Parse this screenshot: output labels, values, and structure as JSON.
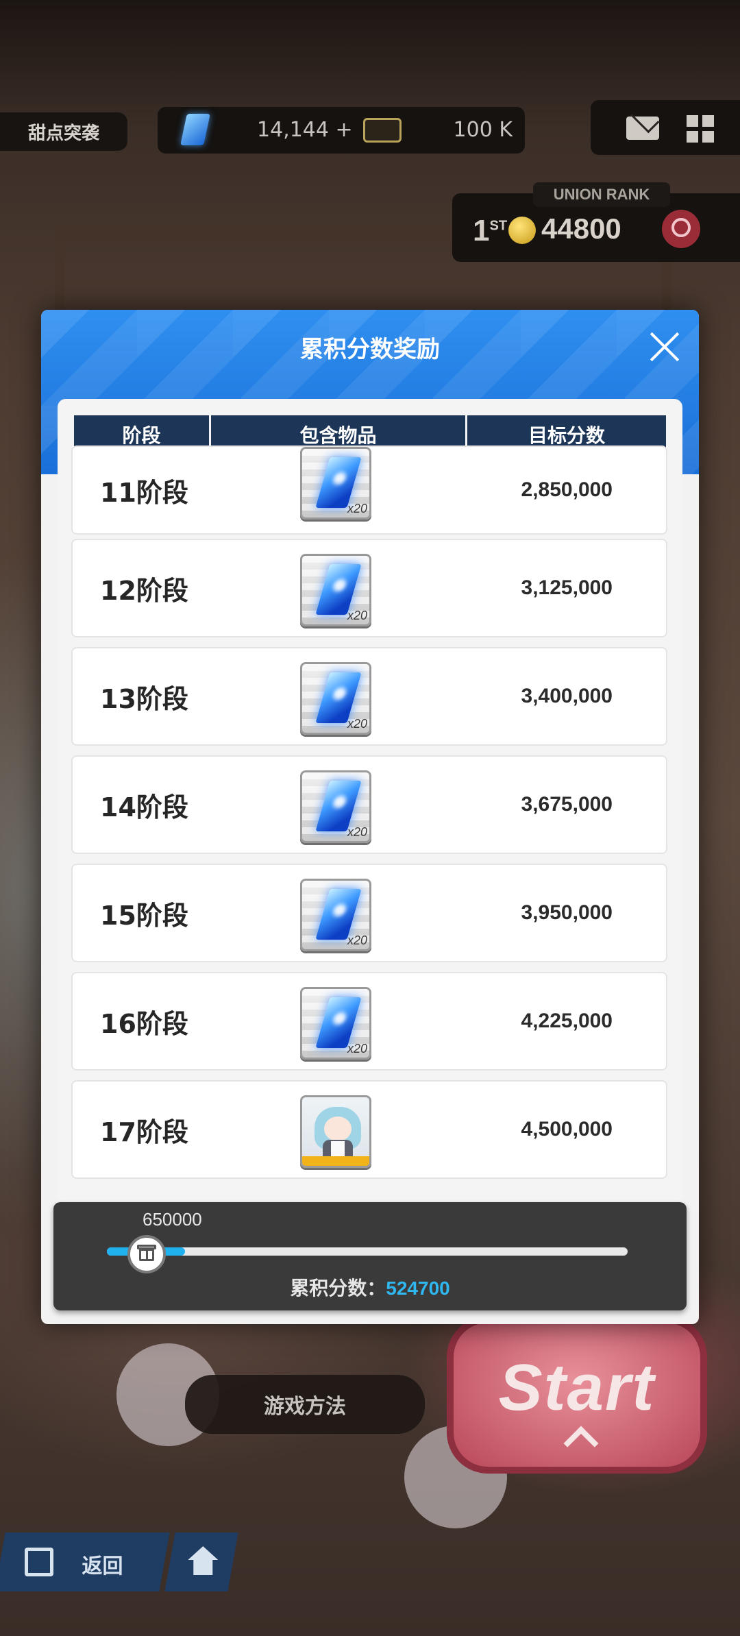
{
  "top_bar": {
    "event_name": "甜点突袭",
    "gems": "14,144",
    "gems_plus": "+",
    "credits": "100 K"
  },
  "union": {
    "label": "UNION RANK",
    "rank": "1",
    "rank_suffix": "ST",
    "score": "44800"
  },
  "background_buttons": {
    "how_to_play": "游戏方法",
    "start": "Start",
    "back": "返回"
  },
  "modal": {
    "title": "累积分数奖励",
    "columns": [
      "阶段",
      "包含物品",
      "目标分数"
    ],
    "rows": [
      {
        "stage": "11阶段",
        "item": "gem-x20",
        "qty": "x20",
        "target": "2,850,000"
      },
      {
        "stage": "12阶段",
        "item": "gem-x20",
        "qty": "x20",
        "target": "3,125,000"
      },
      {
        "stage": "13阶段",
        "item": "gem-x20",
        "qty": "x20",
        "target": "3,400,000"
      },
      {
        "stage": "14阶段",
        "item": "gem-x20",
        "qty": "x20",
        "target": "3,675,000"
      },
      {
        "stage": "15阶段",
        "item": "gem-x20",
        "qty": "x20",
        "target": "3,950,000"
      },
      {
        "stage": "16阶段",
        "item": "gem-x20",
        "qty": "x20",
        "target": "4,225,000"
      },
      {
        "stage": "17阶段",
        "item": "character-figure",
        "qty": "",
        "target": "4,500,000"
      }
    ],
    "progress": {
      "milestone": "650000",
      "fill_fraction": 0.15,
      "score_label": "累积分数：",
      "score_value": "524700"
    }
  },
  "colors": {
    "header_blue": "#1a6fd8",
    "table_head_navy": "#1d3557",
    "progress_cyan": "#1fb2ee",
    "start_pink": "#b9485a"
  }
}
